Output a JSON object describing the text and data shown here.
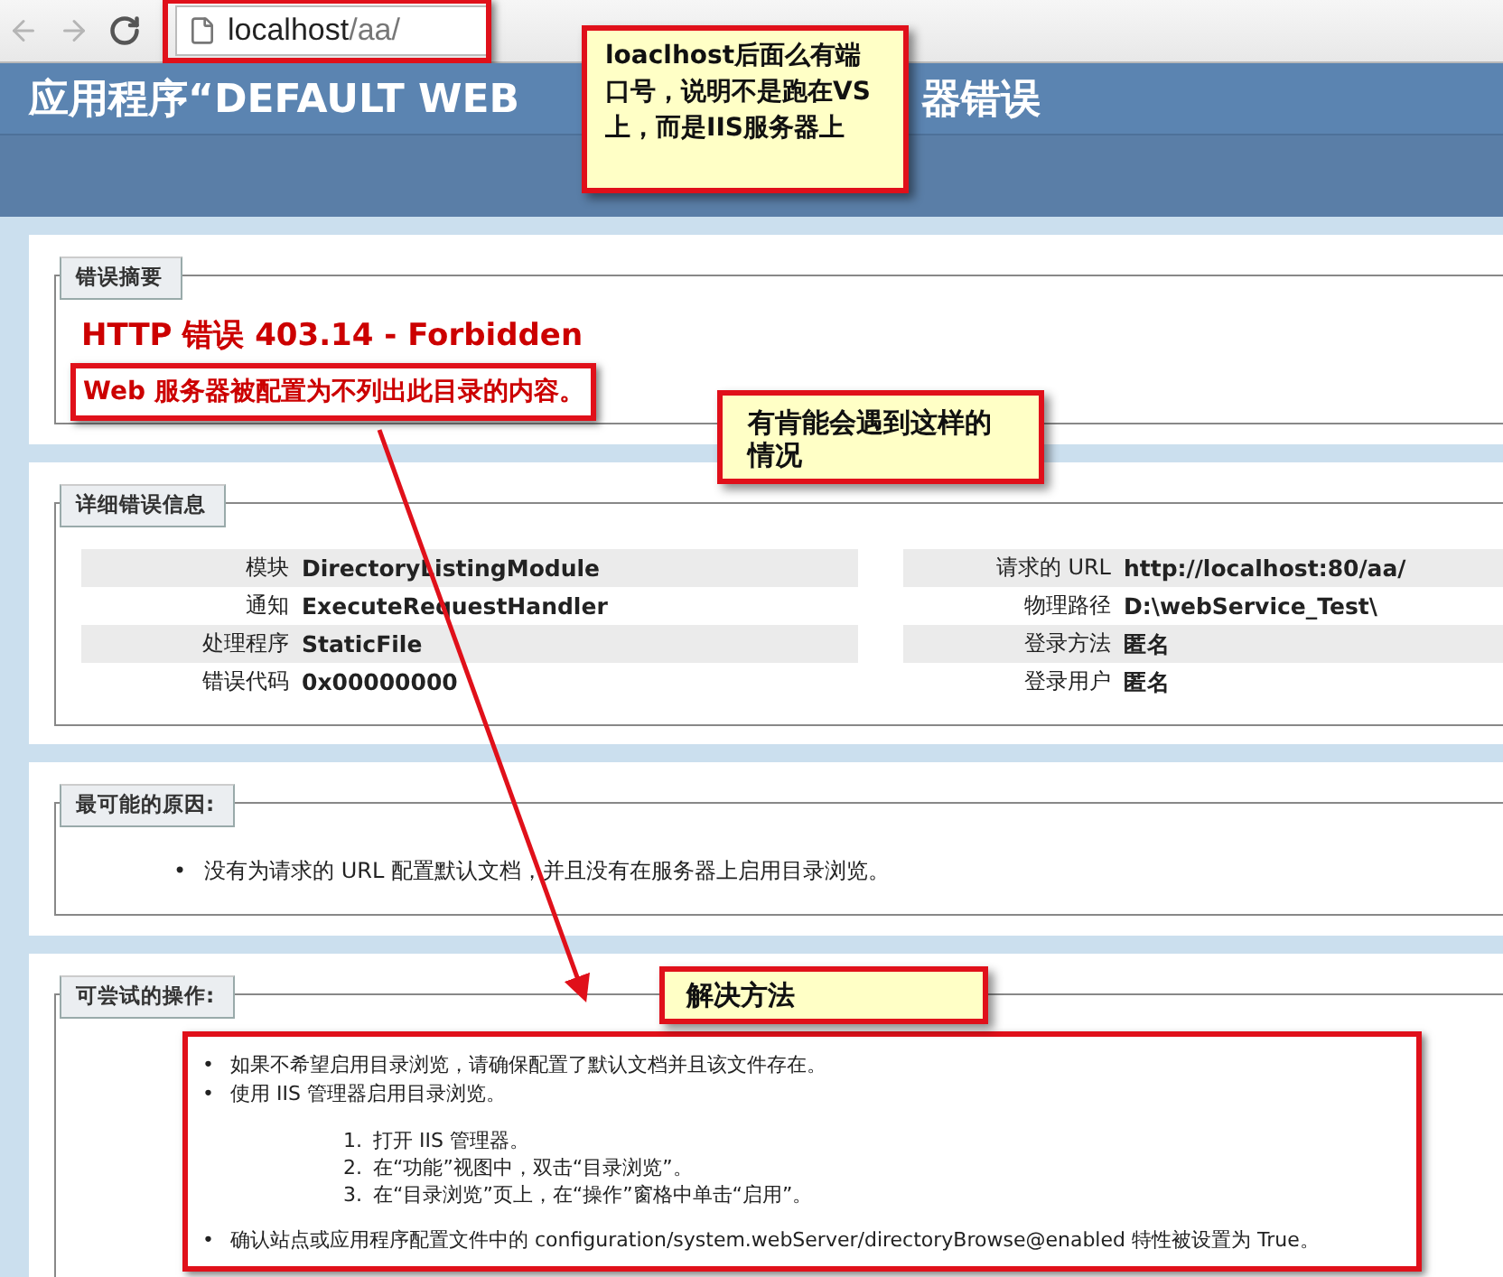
{
  "browser": {
    "address_host": "localhost",
    "address_path": "/aa/"
  },
  "header": {
    "title_parts": [
      "应用程序“DEFAULT WEB",
      "器错误"
    ]
  },
  "sections": [
    {
      "kind": "summary",
      "legend": "错误摘要",
      "heading": "HTTP 错误 403.14 - Forbidden",
      "message": "Web 服务器被配置为不列出此目录的内容。"
    },
    {
      "kind": "details",
      "legend": "详细错误信息",
      "columns": [
        [
          {
            "label": "模块",
            "value": "DirectoryListingModule"
          },
          {
            "label": "通知",
            "value": "ExecuteRequestHandler"
          },
          {
            "label": "处理程序",
            "value": "StaticFile"
          },
          {
            "label": "错误代码",
            "value": "0x00000000"
          }
        ],
        [
          {
            "label": "请求的 URL",
            "value": "http://localhost:80/aa/"
          },
          {
            "label": "物理路径",
            "value": "D:\\webService_Test\\"
          },
          {
            "label": "登录方法",
            "value": "匿名"
          },
          {
            "label": "登录用户",
            "value": "匿名"
          }
        ]
      ]
    },
    {
      "kind": "causes",
      "legend": "最可能的原因:",
      "items": [
        {
          "marker": "•",
          "text": "没有为请求的 URL 配置默认文档，并且没有在服务器上启用目录浏览。"
        }
      ]
    },
    {
      "kind": "actions",
      "legend": "可尝试的操作:",
      "items": [
        {
          "marker": "•",
          "text": "如果不希望启用目录浏览，请确保配置了默认文档并且该文件存在。"
        },
        {
          "marker": "•",
          "text": "使用 IIS 管理器启用目录浏览。",
          "steps": [
            {
              "number": "1.",
              "text": "打开 IIS 管理器。"
            },
            {
              "number": "2.",
              "text": "在“功能”视图中，双击“目录浏览”。"
            },
            {
              "number": "3.",
              "text": "在“目录浏览”页上，在“操作”窗格中单击“启用”。"
            }
          ]
        },
        {
          "marker": "•",
          "text": "确认站点或应用程序配置文件中的 configuration/system.webServer/directoryBrowse@enabled 特性被设置为 True。"
        }
      ]
    }
  ],
  "callouts": [
    {
      "text": "loaclhost后面么有端口号，说明不是跑在VS上，而是IIS服务器上"
    },
    {
      "text": "有肯能会遇到这样的情况"
    },
    {
      "text": "解决方法"
    }
  ]
}
